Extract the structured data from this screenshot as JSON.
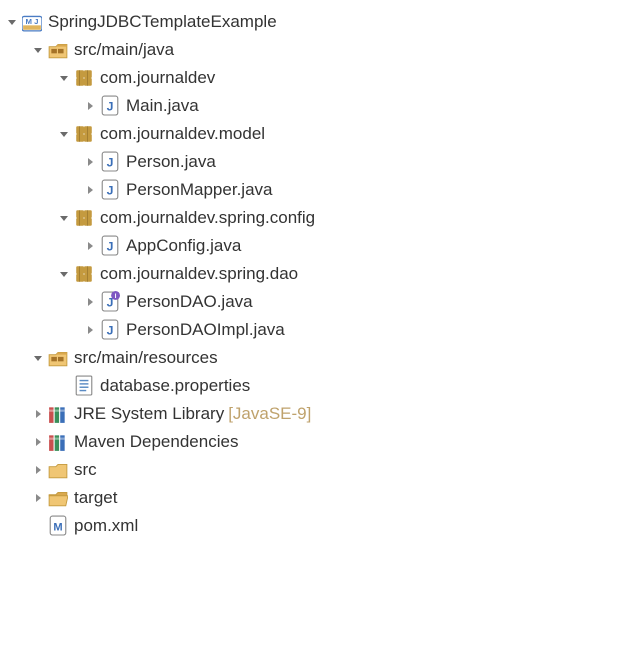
{
  "tree": {
    "project": {
      "name": "SpringJDBCTemplateExample",
      "srcMainJava": {
        "label": "src/main/java",
        "pkg_journaldev": {
          "label": "com.journaldev",
          "main": "Main.java"
        },
        "pkg_model": {
          "label": "com.journaldev.model",
          "person": "Person.java",
          "personMapper": "PersonMapper.java"
        },
        "pkg_config": {
          "label": "com.journaldev.spring.config",
          "appConfig": "AppConfig.java"
        },
        "pkg_dao": {
          "label": "com.journaldev.spring.dao",
          "personDAO": "PersonDAO.java",
          "personDAOImpl": "PersonDAOImpl.java"
        }
      },
      "srcMainResources": {
        "label": "src/main/resources",
        "dbprops": "database.properties"
      },
      "jre": {
        "label": "JRE System Library",
        "suffix": "[JavaSE-9]"
      },
      "maven": {
        "label": "Maven Dependencies"
      },
      "src": {
        "label": "src"
      },
      "target": {
        "label": "target"
      },
      "pom": "pom.xml"
    }
  }
}
